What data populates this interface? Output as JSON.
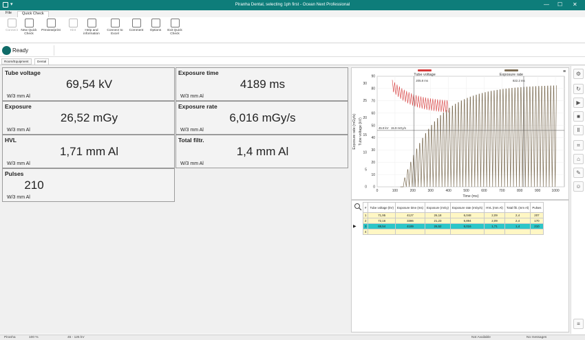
{
  "window": {
    "title": "Piranha Dental, selecting 1ph first - Ocean Next Professional"
  },
  "menu": {
    "file": "File",
    "quick_check": "Quick Check"
  },
  "ribbon": [
    {
      "label": "Connect",
      "icon": "connect-icon",
      "disabled": true
    },
    {
      "label": "New Quick Check",
      "icon": "new-quick-check-icon",
      "disabled": false
    },
    {
      "label": "Preview/print",
      "icon": "preview-print-icon",
      "disabled": false
    },
    {
      "label": "Hint",
      "icon": "hint-icon",
      "disabled": true
    },
    {
      "label": "Help and information",
      "icon": "help-icon",
      "disabled": false
    },
    {
      "label": "Connect to Excel",
      "icon": "excel-icon",
      "disabled": false
    },
    {
      "label": "Comment",
      "icon": "comment-icon",
      "disabled": false
    },
    {
      "label": "Options",
      "icon": "options-icon",
      "disabled": false
    },
    {
      "label": "Exit Quick Check",
      "icon": "exit-icon",
      "disabled": false
    }
  ],
  "status": {
    "text": "Ready"
  },
  "tabs": [
    "Room/Equipment",
    "Dental"
  ],
  "tiles": {
    "tube_voltage": {
      "label": "Tube voltage",
      "value": "69,54 kV",
      "unit": "W/3 mm Al"
    },
    "exposure_time": {
      "label": "Exposure time",
      "value": "4189 ms",
      "unit": "W/3 mm Al"
    },
    "exposure": {
      "label": "Exposure",
      "value": "26,52 mGy",
      "unit": "W/3 mm Al"
    },
    "exposure_rate": {
      "label": "Exposure rate",
      "value": "6,016 mGy/s",
      "unit": "W/3 mm Al"
    },
    "hvl": {
      "label": "HVL",
      "value": "1,71 mm Al",
      "unit": "W/3 mm Al"
    },
    "total_filtr": {
      "label": "Total filtr.",
      "value": "1,4 mm Al",
      "unit": "W/3 mm Al"
    },
    "pulses": {
      "label": "Pulses",
      "value": "210",
      "unit": "W/3 mm Al"
    }
  },
  "chart_data": {
    "type": "line",
    "series": [
      {
        "name": "Tube voltage",
        "color": "#d63b3b"
      },
      {
        "name": "Exposure rate",
        "color": "#7d6e55"
      }
    ],
    "xlabel": "Time (ms)",
    "ylabel_left": "Exposure rate (mGy/s)",
    "ylabel_right": "Tube voltage (kV)",
    "xlim": [
      0,
      1050
    ],
    "x_ticks": [
      0,
      100,
      200,
      300,
      400,
      500,
      600,
      700,
      800,
      900,
      1000
    ],
    "ylim_voltage": [
      0,
      90
    ],
    "voltage_ticks": [
      0,
      10,
      20,
      30,
      40,
      50,
      60,
      70,
      80,
      90
    ],
    "ylim_rate": [
      0,
      32
    ],
    "rate_ticks": [
      0,
      5,
      10,
      15,
      20,
      25,
      30
    ],
    "annotations": {
      "start_time": "205.8 ms",
      "end_time": "822.2 ms",
      "cursor_kv": "45.9 kV",
      "cursor_rate": "15.9 mGy/s"
    },
    "cursor_x": [
      205.8,
      822.2
    ],
    "cursor_voltage": 45.9,
    "voltage_start": 87,
    "voltage_settle": 69.5,
    "voltage_ripple": 10,
    "rate_max": 29.5,
    "rate_first_pulse_ms": 130,
    "pulse_period_ms": 16.7
  },
  "table": {
    "headers": [
      "#",
      "Tube voltage (kV)",
      "Exposure time (ms)",
      "Exposure (mGy)",
      "Exposure rate (mGy/s)",
      "HVL (mm Al)",
      "Total filt. (mm Al)",
      "Pulses"
    ],
    "rows": [
      [
        "1",
        "71,95",
        "4127",
        "26,18",
        "6,048",
        "2,09",
        "2,4",
        "207"
      ],
      [
        "2",
        "72,16",
        "3386",
        "21,23",
        "5,894",
        "2,09",
        "2,4",
        "170"
      ],
      [
        "3",
        "69,54",
        "4189",
        "26,52",
        "6,016",
        "1,71",
        "1,4",
        "210"
      ],
      [
        "4",
        "",
        "",
        "",
        "",
        "",
        "",
        ""
      ]
    ]
  },
  "bottom": {
    "device": "Piranha",
    "battery": "100 %",
    "range": "45 - 125 kV",
    "availability": "Not Available",
    "messages": "No messages"
  }
}
